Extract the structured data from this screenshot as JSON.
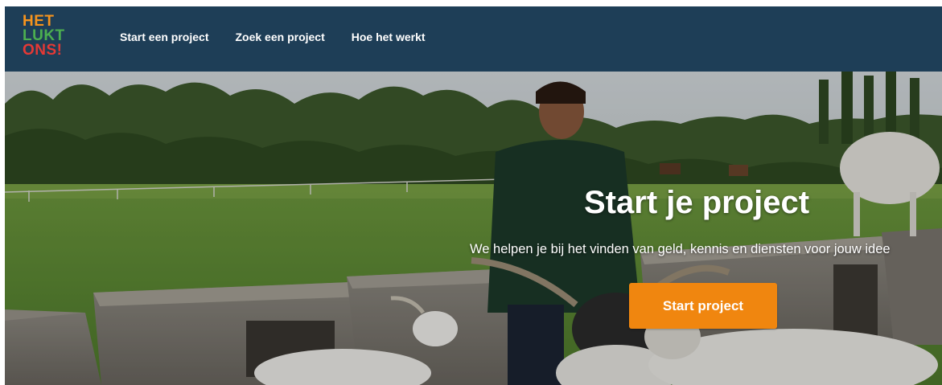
{
  "brand": {
    "logo_lines": [
      "HET",
      "LUKT",
      "ONS!"
    ],
    "colors": {
      "logo_line1": "#f7941d",
      "logo_line2": "#4caf50",
      "logo_line3": "#e53935",
      "navbar_bg": "#1e3e57",
      "accent_button": "#f0860f"
    }
  },
  "nav": {
    "items": [
      {
        "label": "Start een project"
      },
      {
        "label": "Zoek een project"
      },
      {
        "label": "Hoe het werkt"
      }
    ]
  },
  "hero": {
    "background_image": "farm-meadow-girl-with-goats-photo",
    "title": "Start je project",
    "subtitle": "We helpen je bij het vinden van geld, kennis en diensten voor jouw idee",
    "cta_label": "Start project"
  }
}
